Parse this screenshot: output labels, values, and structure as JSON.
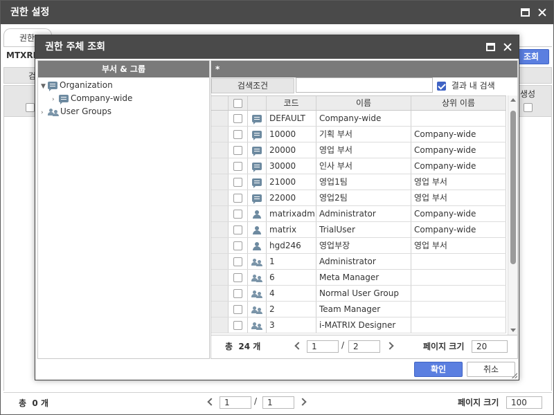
{
  "outer": {
    "title": "권한 설정",
    "tab_label": "권한",
    "code_label": "MTXRP",
    "search_button": "조회",
    "filter_label": "검",
    "column_generate": "생성",
    "footer": {
      "total_label": "총",
      "total_count": "0",
      "total_unit": "개",
      "page_current": "1",
      "page_sep": "/",
      "page_total": "1",
      "page_size_label": "페이지 크기",
      "page_size": "100"
    }
  },
  "modal": {
    "title": "권한 주체 조회",
    "left_header": "부서 & 그룹",
    "tree": [
      {
        "label": "Organization",
        "icon": "department-icon",
        "expanded": true,
        "level": 0
      },
      {
        "label": "Company-wide",
        "icon": "department-icon",
        "expanded": false,
        "level": 1
      },
      {
        "label": "User Groups",
        "icon": "user-group-icon",
        "expanded": false,
        "level": 0
      }
    ],
    "right_header": "*",
    "search_label": "검색조건",
    "search_value": "",
    "search_within_label": "결과 내 검색",
    "search_within_checked": true,
    "columns": {
      "code": "코드",
      "name": "이름",
      "parent": "상위 이름"
    },
    "rows": [
      {
        "type": "department-icon",
        "code": "DEFAULT",
        "name": "Company-wide",
        "parent": ""
      },
      {
        "type": "department-icon",
        "code": "10000",
        "name": "기획 부서",
        "parent": "Company-wide"
      },
      {
        "type": "department-icon",
        "code": "20000",
        "name": "영업 부서",
        "parent": "Company-wide"
      },
      {
        "type": "department-icon",
        "code": "30000",
        "name": "인사 부서",
        "parent": "Company-wide"
      },
      {
        "type": "department-icon",
        "code": "21000",
        "name": "영업1팀",
        "parent": "영업 부서"
      },
      {
        "type": "department-icon",
        "code": "22000",
        "name": "영업2팀",
        "parent": "영업 부서"
      },
      {
        "type": "user-icon",
        "code": "matrixadm",
        "name": "Administrator",
        "parent": "Company-wide"
      },
      {
        "type": "user-icon",
        "code": "matrix",
        "name": "TrialUser",
        "parent": "Company-wide"
      },
      {
        "type": "user-icon",
        "code": "hgd246",
        "name": "영업부장",
        "parent": "영업 부서"
      },
      {
        "type": "user-group-icon",
        "code": "1",
        "name": "Administrator",
        "parent": ""
      },
      {
        "type": "user-group-icon",
        "code": "6",
        "name": "Meta Manager",
        "parent": ""
      },
      {
        "type": "user-group-icon",
        "code": "4",
        "name": "Normal User Group",
        "parent": ""
      },
      {
        "type": "user-group-icon",
        "code": "2",
        "name": "Team Manager",
        "parent": ""
      },
      {
        "type": "user-group-icon",
        "code": "3",
        "name": "i-MATRIX Designer",
        "parent": ""
      }
    ],
    "footer": {
      "total_label": "총",
      "total_count": "24",
      "total_unit": "개",
      "page_current": "1",
      "page_sep": "/",
      "page_total": "2",
      "page_size_label": "페이지 크기",
      "page_size": "20"
    },
    "ok_label": "확인",
    "cancel_label": "취소"
  },
  "colors": {
    "title_bar": "#4a4a4a",
    "pane_header": "#7a7a7a",
    "accent": "#5b7fe0",
    "icon": "#6d8aa0"
  }
}
